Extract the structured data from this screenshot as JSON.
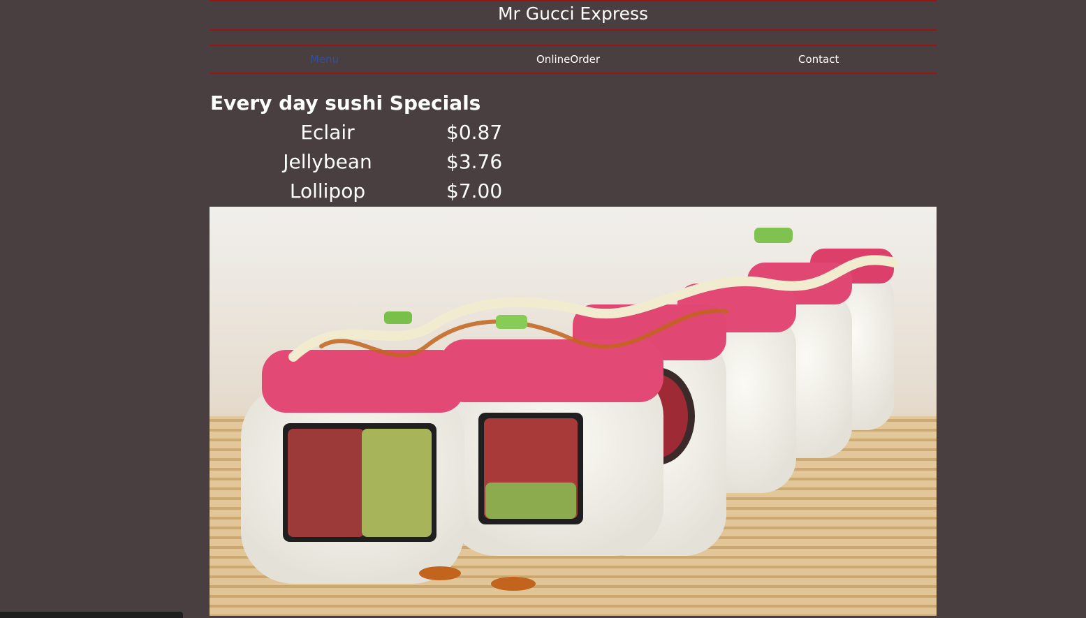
{
  "header": {
    "title": "Mr Gucci Express"
  },
  "nav": {
    "items": [
      {
        "label": "Menu",
        "active": true
      },
      {
        "label": "OnlineOrder",
        "active": false
      },
      {
        "label": "Contact",
        "active": false
      }
    ]
  },
  "specials": {
    "heading": "Every day sushi Specials",
    "items": [
      {
        "name": "Eclair",
        "price": "$0.87"
      },
      {
        "name": "Jellybean",
        "price": "$3.76"
      },
      {
        "name": "Lollipop",
        "price": "$7.00"
      }
    ]
  },
  "colors": {
    "background": "#4a3f40",
    "rule": "#9c1313",
    "active_link": "#2f4f9f"
  },
  "photo": {
    "icon": "sushi-roll-photo"
  }
}
